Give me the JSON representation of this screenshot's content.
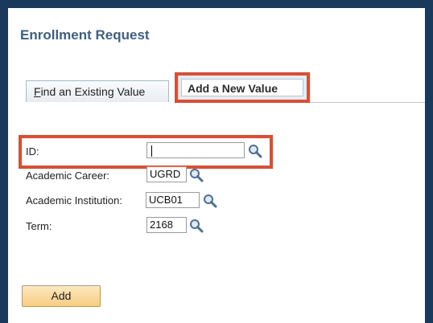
{
  "page": {
    "title": "Enrollment Request"
  },
  "tabs": {
    "find_prefix": "F",
    "find_rest": "ind an Existing Value",
    "add": "Add a New Value"
  },
  "fields": {
    "id": {
      "label": "ID:",
      "value": ""
    },
    "career": {
      "label": "Academic Career:",
      "value": "UGRD"
    },
    "institution": {
      "label": "Academic Institution:",
      "value": "UCB01"
    },
    "term": {
      "label": "Term:",
      "value": "2168"
    }
  },
  "buttons": {
    "add": "Add"
  },
  "colors": {
    "frame": "#1a3a5c",
    "highlight": "#e04c2f",
    "title": "#3d5f85",
    "button": "#f7cd80"
  },
  "icons": {
    "lookup": "magnifier-icon"
  }
}
